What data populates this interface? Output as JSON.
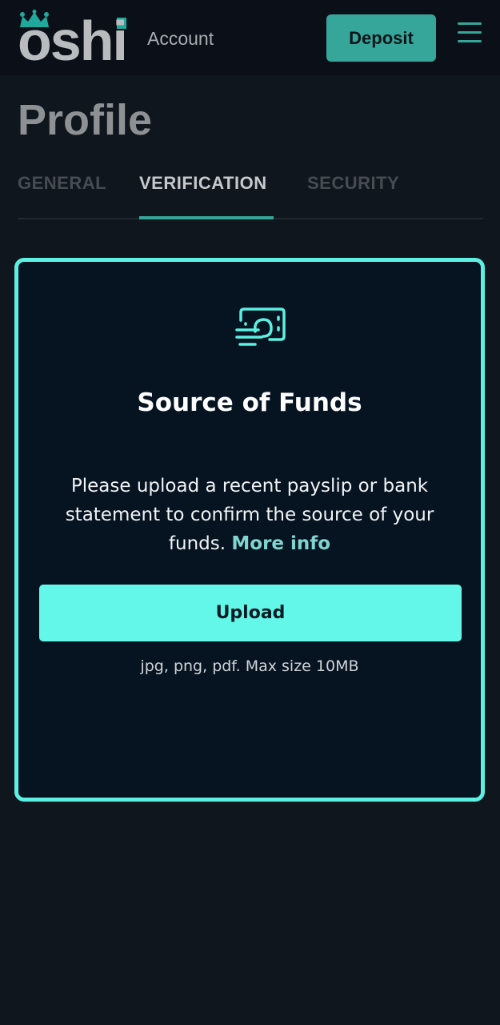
{
  "header": {
    "logo_text": "oshi",
    "section_title": "Account",
    "deposit_label": "Deposit",
    "menu_icon": "hamburger-menu-icon"
  },
  "page": {
    "title": "Profile"
  },
  "tabs": [
    {
      "label": "GENERAL",
      "active": false
    },
    {
      "label": "VERIFICATION",
      "active": true
    },
    {
      "label": "SECURITY",
      "active": false
    }
  ],
  "card": {
    "icon": "cash-payslip-icon",
    "title": "Source of Funds",
    "description": "Please upload a recent payslip or bank statement to confirm the source of your funds.",
    "more_info_label": "More info",
    "upload_label": "Upload",
    "upload_hint": "jpg, png, pdf. Max size 10MB"
  },
  "colors": {
    "accent": "#63f7ea",
    "brand_teal": "#36a69a",
    "background": "#10161e",
    "card_background": "#061421"
  }
}
